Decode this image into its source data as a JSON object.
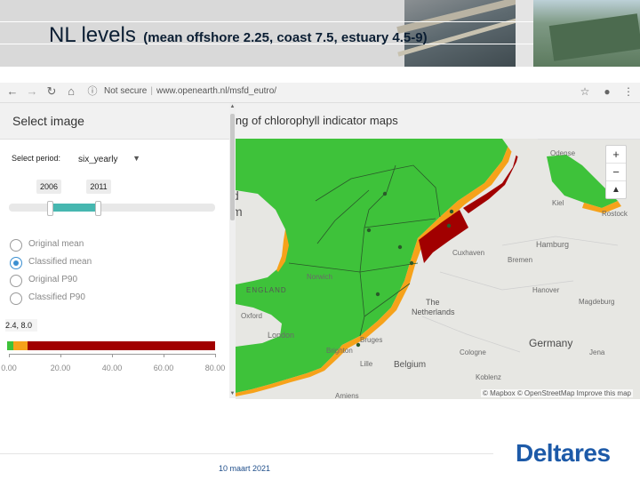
{
  "slide": {
    "title_main": "NL levels",
    "title_sub": "(mean offshore 2.25, coast 7.5, estuary 4.5-9)",
    "date": "10 maart 2021",
    "logo": "Deltares"
  },
  "browser": {
    "back_icon": "back-arrow-icon",
    "forward_icon": "forward-arrow-icon",
    "reload_icon": "reload-icon",
    "home_icon": "home-icon",
    "security_label": "Not secure",
    "url": "www.openearth.nl/msfd_eutro/",
    "bookmark_icon": "star-icon",
    "account_icon": "account-icon",
    "menu_icon": "kebab-menu-icon"
  },
  "panel": {
    "title": "Select image",
    "period_label": "Select period:",
    "period_value": "six_yearly",
    "year_start": "2006",
    "year_end": "2011",
    "range_fraction": [
      0.2,
      0.43
    ],
    "options": [
      {
        "label": "Original mean",
        "checked": false
      },
      {
        "label": "Classified mean",
        "checked": true
      },
      {
        "label": "Original P90",
        "checked": false
      },
      {
        "label": "Classified P90",
        "checked": false
      }
    ],
    "threshold_text": "2.4, 8.0",
    "axis_ticks": [
      "0.00",
      "20.00",
      "40.00",
      "60.00",
      "80.00"
    ],
    "axis_range": [
      0,
      80
    ],
    "class_breaks": [
      2.4,
      8.0
    ],
    "class_colors": [
      "#3ec23a",
      "#f6a21a",
      "#a10000"
    ]
  },
  "map": {
    "title": "ing of chlorophyll indicator maps",
    "labels": {
      "england": "ENGLAND",
      "netherlands_1": "The",
      "netherlands_2": "Netherlands",
      "germany": "Germany",
      "belgium": "Belgium",
      "london": "London",
      "norwich": "Norwich",
      "oxford": "Oxford",
      "brighton": "Brighton",
      "lille": "Lille",
      "amiens": "Amiens",
      "bruges": "Bruges",
      "cologne": "Cologne",
      "koblenz": "Koblenz",
      "jena": "Jena",
      "hamburg": "Hamburg",
      "bremen": "Bremen",
      "hanover": "Hanover",
      "magdeburg": "Magdeburg",
      "kiel": "Kiel",
      "rostock": "Rostock",
      "odense": "Odense",
      "cuxhaven": "Cuxhaven",
      "partial_d": "d",
      "partial_m": "m"
    },
    "zoom_in": "+",
    "zoom_out": "−",
    "compass": "▲",
    "attribution": "© Mapbox © OpenStreetMap Improve this map",
    "colors": {
      "green": "#3ec23a",
      "orange": "#f6a21a",
      "darkred": "#a10000",
      "land": "#e7e7e3"
    }
  }
}
